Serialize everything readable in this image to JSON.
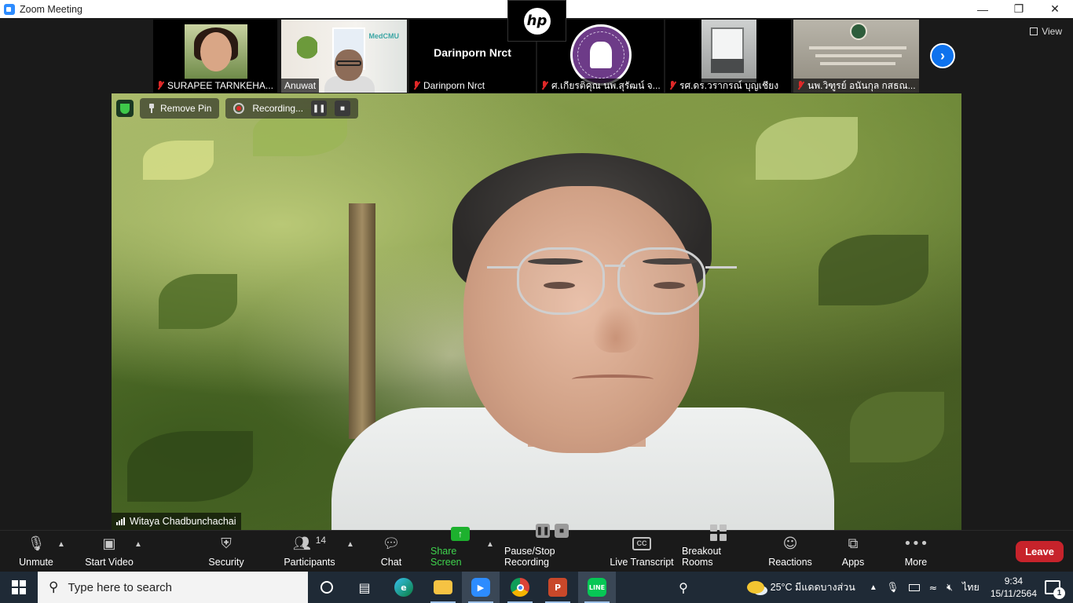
{
  "window": {
    "title": "Zoom Meeting",
    "controls": [
      "minimize-icon",
      "maximize-icon",
      "close-icon"
    ]
  },
  "hp_overlay": {
    "text": "hp"
  },
  "view_button": {
    "label": "View"
  },
  "thumbnails": [
    {
      "name": "SURAPEE TARNKEHA...",
      "muted": true,
      "kind": "video"
    },
    {
      "name": "Anuwat",
      "muted": false,
      "kind": "video"
    },
    {
      "name": "Darinporn Nrct",
      "muted": true,
      "kind": "name-only",
      "big_name": "Darinporn Nrct"
    },
    {
      "name": "ศ.เกียรติคุณ นพ.สุรัฒน์ จ...",
      "muted": true,
      "kind": "logo"
    },
    {
      "name": "รศ.ดร.วรากรณ์ บุญเชียง",
      "muted": true,
      "kind": "video"
    },
    {
      "name": "นพ.วิฑูรย์ อนันกุล กสธณ...",
      "muted": true,
      "kind": "video"
    }
  ],
  "main_video": {
    "remove_pin_label": "Remove Pin",
    "recording_label": "Recording...",
    "speaker_name": "Witaya Chadbunchachai"
  },
  "toolbar": {
    "unmute": "Unmute",
    "start_video": "Start Video",
    "security": "Security",
    "participants": "Participants",
    "participants_count": "14",
    "chat": "Chat",
    "share_screen": "Share Screen",
    "pause_stop_recording": "Pause/Stop Recording",
    "live_transcript": "Live Transcript",
    "breakout_rooms": "Breakout Rooms",
    "reactions": "Reactions",
    "apps": "Apps",
    "more": "More",
    "leave": "Leave",
    "cc_text": "CC"
  },
  "taskbar": {
    "search_placeholder": "Type here to search",
    "apps": [
      "cortana-icon",
      "task-view-icon",
      "edge-icon",
      "file-explorer-icon",
      "zoom-icon",
      "chrome-icon",
      "powerpoint-icon",
      "line-icon"
    ],
    "weather": "25°C  มีแดดบางส่วน",
    "language": "ไทย",
    "time": "9:34",
    "date": "15/11/2564",
    "notification_count": "1"
  },
  "colors": {
    "zoom_blue": "#0e72ed",
    "leave_red": "#c7232b",
    "share_green": "#1db12e",
    "toolbar_bg": "#1a1a1a",
    "taskbar_bg": "#1f2a36"
  }
}
